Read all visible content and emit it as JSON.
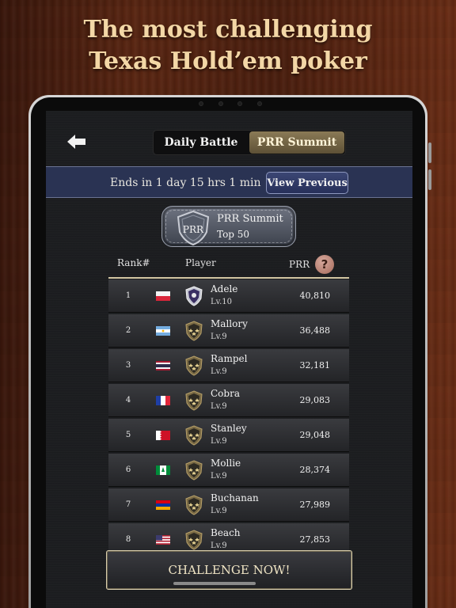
{
  "headline": {
    "line1": "The most challenging",
    "line2": "Texas Hold’em poker"
  },
  "tabs": {
    "daily": "Daily Battle",
    "prr": "PRR Summit"
  },
  "banner": {
    "ends": "Ends in 1 day 15 hrs 1 min",
    "view_previous": "View Previous"
  },
  "badge": {
    "shield_text": "PRR",
    "title": "PRR Summit",
    "subtitle": "Top 50"
  },
  "columns": {
    "rank": "Rank#",
    "player": "Player",
    "prr": "PRR",
    "help": "?"
  },
  "rows": [
    {
      "rank": "1",
      "name": "Adele",
      "level": "Lv.10",
      "score": "40,810",
      "flag": "poland-flag-icon",
      "tier": "purple"
    },
    {
      "rank": "2",
      "name": "Mallory",
      "level": "Lv.9",
      "score": "36,488",
      "flag": "argentina-flag-icon",
      "tier": "gold"
    },
    {
      "rank": "3",
      "name": "Rampel",
      "level": "Lv.9",
      "score": "32,181",
      "flag": "thailand-flag-icon",
      "tier": "gold"
    },
    {
      "rank": "4",
      "name": "Cobra",
      "level": "Lv.9",
      "score": "29,083",
      "flag": "france-flag-icon",
      "tier": "gold"
    },
    {
      "rank": "5",
      "name": "Stanley",
      "level": "Lv.9",
      "score": "29,048",
      "flag": "bahrain-flag-icon",
      "tier": "gold"
    },
    {
      "rank": "6",
      "name": "Mollie",
      "level": "Lv.9",
      "score": "28,374",
      "flag": "norfolk-island-flag-icon",
      "tier": "gold"
    },
    {
      "rank": "7",
      "name": "Buchanan",
      "level": "Lv.9",
      "score": "27,989",
      "flag": "armenia-flag-icon",
      "tier": "gold"
    },
    {
      "rank": "8",
      "name": "Beach",
      "level": "Lv.9",
      "score": "27,853",
      "flag": "usa-flag-icon",
      "tier": "gold"
    }
  ],
  "challenge": "CHALLENGE NOW!",
  "colors": {
    "headline": "#f3d7a6",
    "banner": "#2a3353",
    "active_tab": "#7a6a48",
    "help": "#c08878"
  }
}
